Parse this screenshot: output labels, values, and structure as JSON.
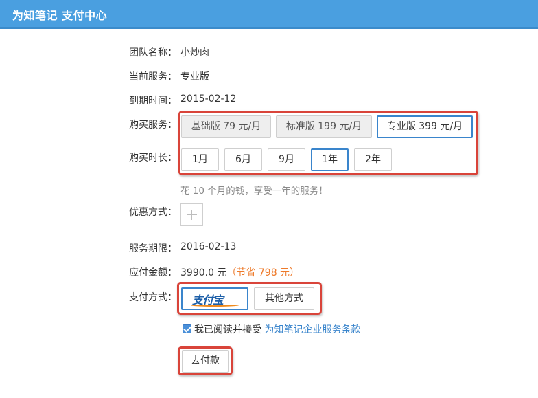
{
  "header": {
    "title": "为知笔记 支付中心"
  },
  "team": {
    "label": "团队名称：",
    "value": "小炒肉"
  },
  "current_service": {
    "label": "当前服务：",
    "value": "专业版"
  },
  "expire": {
    "label": "到期时间：",
    "value": "2015-02-12"
  },
  "purchase_service": {
    "label": "购买服务：",
    "options": [
      "基础版 79 元/月",
      "标准版 199 元/月",
      "专业版 399 元/月"
    ],
    "selected": "专业版 399 元/月"
  },
  "duration": {
    "label": "购买时长：",
    "options": [
      "1月",
      "6月",
      "9月",
      "1年",
      "2年"
    ],
    "selected": "1年",
    "hint": "花 10 个月的钱，享受一年的服务！"
  },
  "discount": {
    "label": "优惠方式："
  },
  "service_period": {
    "label": "服务期限：",
    "value": "2016-02-13"
  },
  "amount": {
    "label": "应付金额：",
    "value": "3990.0 元",
    "savings": "（节省 798 元）"
  },
  "payment": {
    "label": "支付方式：",
    "alipay_logo": "支付宝",
    "other_label": "其他方式",
    "selected": "alipay"
  },
  "agreement": {
    "checked": true,
    "text": "我已阅读并接受",
    "link": "为知笔记企业服务条款"
  },
  "pay_button": "去付款",
  "colors": {
    "header": "#4a9fe0",
    "accent": "#3a85cc",
    "highlight_box": "#d9443a",
    "savings": "#ee7a2a"
  }
}
